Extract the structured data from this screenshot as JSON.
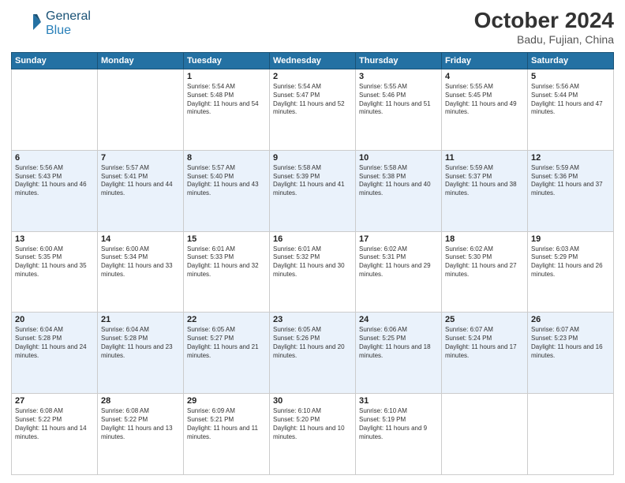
{
  "logo": {
    "general": "General",
    "blue": "Blue"
  },
  "header": {
    "month": "October 2024",
    "location": "Badu, Fujian, China"
  },
  "weekdays": [
    "Sunday",
    "Monday",
    "Tuesday",
    "Wednesday",
    "Thursday",
    "Friday",
    "Saturday"
  ],
  "weeks": [
    [
      {
        "day": "",
        "info": ""
      },
      {
        "day": "",
        "info": ""
      },
      {
        "day": "1",
        "info": "Sunrise: 5:54 AM\nSunset: 5:48 PM\nDaylight: 11 hours and 54 minutes."
      },
      {
        "day": "2",
        "info": "Sunrise: 5:54 AM\nSunset: 5:47 PM\nDaylight: 11 hours and 52 minutes."
      },
      {
        "day": "3",
        "info": "Sunrise: 5:55 AM\nSunset: 5:46 PM\nDaylight: 11 hours and 51 minutes."
      },
      {
        "day": "4",
        "info": "Sunrise: 5:55 AM\nSunset: 5:45 PM\nDaylight: 11 hours and 49 minutes."
      },
      {
        "day": "5",
        "info": "Sunrise: 5:56 AM\nSunset: 5:44 PM\nDaylight: 11 hours and 47 minutes."
      }
    ],
    [
      {
        "day": "6",
        "info": "Sunrise: 5:56 AM\nSunset: 5:43 PM\nDaylight: 11 hours and 46 minutes."
      },
      {
        "day": "7",
        "info": "Sunrise: 5:57 AM\nSunset: 5:41 PM\nDaylight: 11 hours and 44 minutes."
      },
      {
        "day": "8",
        "info": "Sunrise: 5:57 AM\nSunset: 5:40 PM\nDaylight: 11 hours and 43 minutes."
      },
      {
        "day": "9",
        "info": "Sunrise: 5:58 AM\nSunset: 5:39 PM\nDaylight: 11 hours and 41 minutes."
      },
      {
        "day": "10",
        "info": "Sunrise: 5:58 AM\nSunset: 5:38 PM\nDaylight: 11 hours and 40 minutes."
      },
      {
        "day": "11",
        "info": "Sunrise: 5:59 AM\nSunset: 5:37 PM\nDaylight: 11 hours and 38 minutes."
      },
      {
        "day": "12",
        "info": "Sunrise: 5:59 AM\nSunset: 5:36 PM\nDaylight: 11 hours and 37 minutes."
      }
    ],
    [
      {
        "day": "13",
        "info": "Sunrise: 6:00 AM\nSunset: 5:35 PM\nDaylight: 11 hours and 35 minutes."
      },
      {
        "day": "14",
        "info": "Sunrise: 6:00 AM\nSunset: 5:34 PM\nDaylight: 11 hours and 33 minutes."
      },
      {
        "day": "15",
        "info": "Sunrise: 6:01 AM\nSunset: 5:33 PM\nDaylight: 11 hours and 32 minutes."
      },
      {
        "day": "16",
        "info": "Sunrise: 6:01 AM\nSunset: 5:32 PM\nDaylight: 11 hours and 30 minutes."
      },
      {
        "day": "17",
        "info": "Sunrise: 6:02 AM\nSunset: 5:31 PM\nDaylight: 11 hours and 29 minutes."
      },
      {
        "day": "18",
        "info": "Sunrise: 6:02 AM\nSunset: 5:30 PM\nDaylight: 11 hours and 27 minutes."
      },
      {
        "day": "19",
        "info": "Sunrise: 6:03 AM\nSunset: 5:29 PM\nDaylight: 11 hours and 26 minutes."
      }
    ],
    [
      {
        "day": "20",
        "info": "Sunrise: 6:04 AM\nSunset: 5:28 PM\nDaylight: 11 hours and 24 minutes."
      },
      {
        "day": "21",
        "info": "Sunrise: 6:04 AM\nSunset: 5:28 PM\nDaylight: 11 hours and 23 minutes."
      },
      {
        "day": "22",
        "info": "Sunrise: 6:05 AM\nSunset: 5:27 PM\nDaylight: 11 hours and 21 minutes."
      },
      {
        "day": "23",
        "info": "Sunrise: 6:05 AM\nSunset: 5:26 PM\nDaylight: 11 hours and 20 minutes."
      },
      {
        "day": "24",
        "info": "Sunrise: 6:06 AM\nSunset: 5:25 PM\nDaylight: 11 hours and 18 minutes."
      },
      {
        "day": "25",
        "info": "Sunrise: 6:07 AM\nSunset: 5:24 PM\nDaylight: 11 hours and 17 minutes."
      },
      {
        "day": "26",
        "info": "Sunrise: 6:07 AM\nSunset: 5:23 PM\nDaylight: 11 hours and 16 minutes."
      }
    ],
    [
      {
        "day": "27",
        "info": "Sunrise: 6:08 AM\nSunset: 5:22 PM\nDaylight: 11 hours and 14 minutes."
      },
      {
        "day": "28",
        "info": "Sunrise: 6:08 AM\nSunset: 5:22 PM\nDaylight: 11 hours and 13 minutes."
      },
      {
        "day": "29",
        "info": "Sunrise: 6:09 AM\nSunset: 5:21 PM\nDaylight: 11 hours and 11 minutes."
      },
      {
        "day": "30",
        "info": "Sunrise: 6:10 AM\nSunset: 5:20 PM\nDaylight: 11 hours and 10 minutes."
      },
      {
        "day": "31",
        "info": "Sunrise: 6:10 AM\nSunset: 5:19 PM\nDaylight: 11 hours and 9 minutes."
      },
      {
        "day": "",
        "info": ""
      },
      {
        "day": "",
        "info": ""
      }
    ]
  ]
}
